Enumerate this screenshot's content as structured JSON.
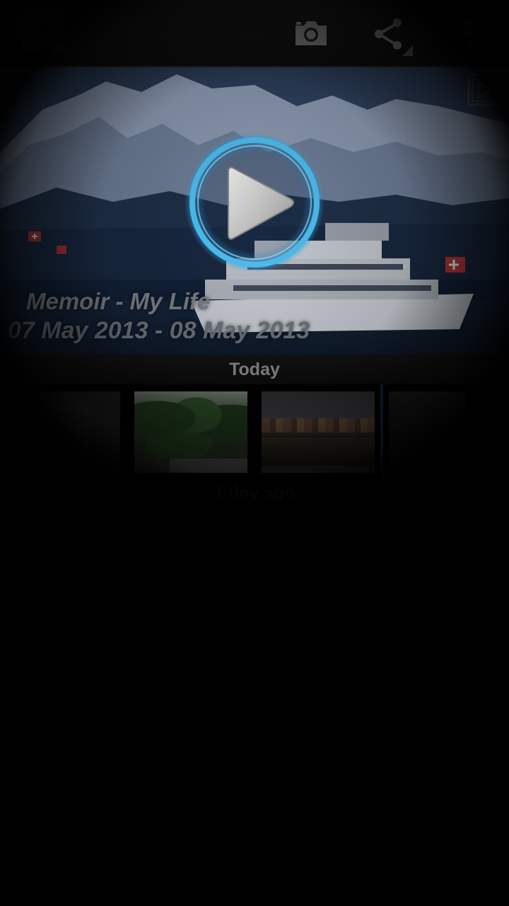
{
  "action_bar": {
    "app_icon": "gallery-thumbnail",
    "buttons": [
      {
        "icon": "camera-icon"
      },
      {
        "icon": "share-icon"
      },
      {
        "icon": "overflow-menu-icon"
      }
    ]
  },
  "memoir": {
    "title": "Memoir - My Life",
    "dates": "07 May 2013 - 08 May 2013",
    "play_icon": "play-icon",
    "slideshow_icon": "slideshow-icon",
    "accent_color": "#2fa8e6"
  },
  "sections": [
    {
      "header": "Today",
      "thumbnails": [
        {
          "icon": "photo-thumbnail"
        },
        {
          "icon": "photo-thumbnail"
        },
        {
          "icon": "photo-thumbnail"
        },
        {
          "icon": "photo-thumbnail"
        }
      ]
    },
    {
      "header": "1 day ago"
    }
  ]
}
